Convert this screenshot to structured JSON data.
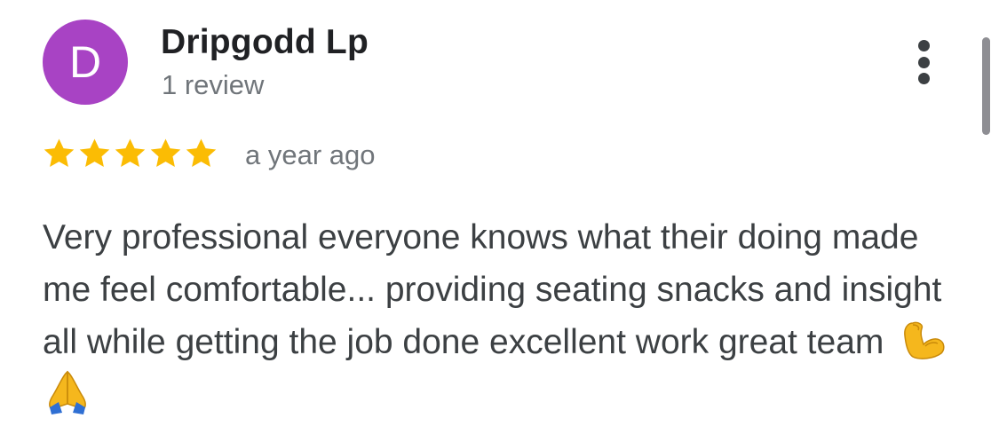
{
  "reviewer": {
    "avatar_letter": "D",
    "avatar_color": "#a843c4",
    "name": "Dripgodd Lp",
    "review_count": "1 review"
  },
  "more_menu": {
    "icon": "more-vert-icon"
  },
  "review": {
    "rating": 5,
    "max_rating": 5,
    "star_color": "#fbbc04",
    "timestamp": "a year ago",
    "text": "Very professional everyone knows what their doing made me feel comfortable... providing seating snacks and insight all while getting the job done excellent work great team",
    "emojis": [
      "flexed-biceps-emoji",
      "folded-hands-emoji"
    ]
  }
}
